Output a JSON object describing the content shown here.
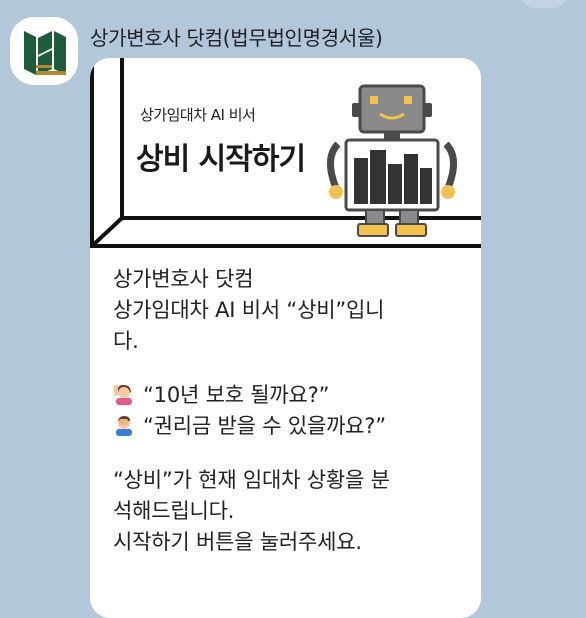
{
  "chat": {
    "sender_name": "상가변호사 닷컴(법무법인명경서울)"
  },
  "card": {
    "banner": {
      "subtitle": "상가임대차 AI 비서",
      "title": "상비 시작하기"
    },
    "message": {
      "lines": {
        "l1": "상가변호사 닷컴",
        "l2": "상가임대차 AI 비서 “상비”입니",
        "l3": "다.",
        "q1": "“10년 보호 될까요?”",
        "q2": "“권리금 받을 수 있을까요?”",
        "l4": "“상비”가 현재 임대차 상황을 분",
        "l5": "석해드립니다.",
        "l6": "시작하기 버튼을 눌러주세요."
      }
    }
  },
  "icons": {
    "avatar": "law-firm-logo-icon",
    "robot": "robot-illustration",
    "q1_emoji": "woman-raising-hand-emoji",
    "q2_emoji": "person-facepalming-emoji"
  },
  "colors": {
    "chat_background": "#b2c7da",
    "logo_green": "#1f5c3b",
    "logo_gold": "#b08a2e",
    "robot_gold": "#f2c14e",
    "robot_gray": "#8a8a8a",
    "banner_border": "#111111"
  }
}
